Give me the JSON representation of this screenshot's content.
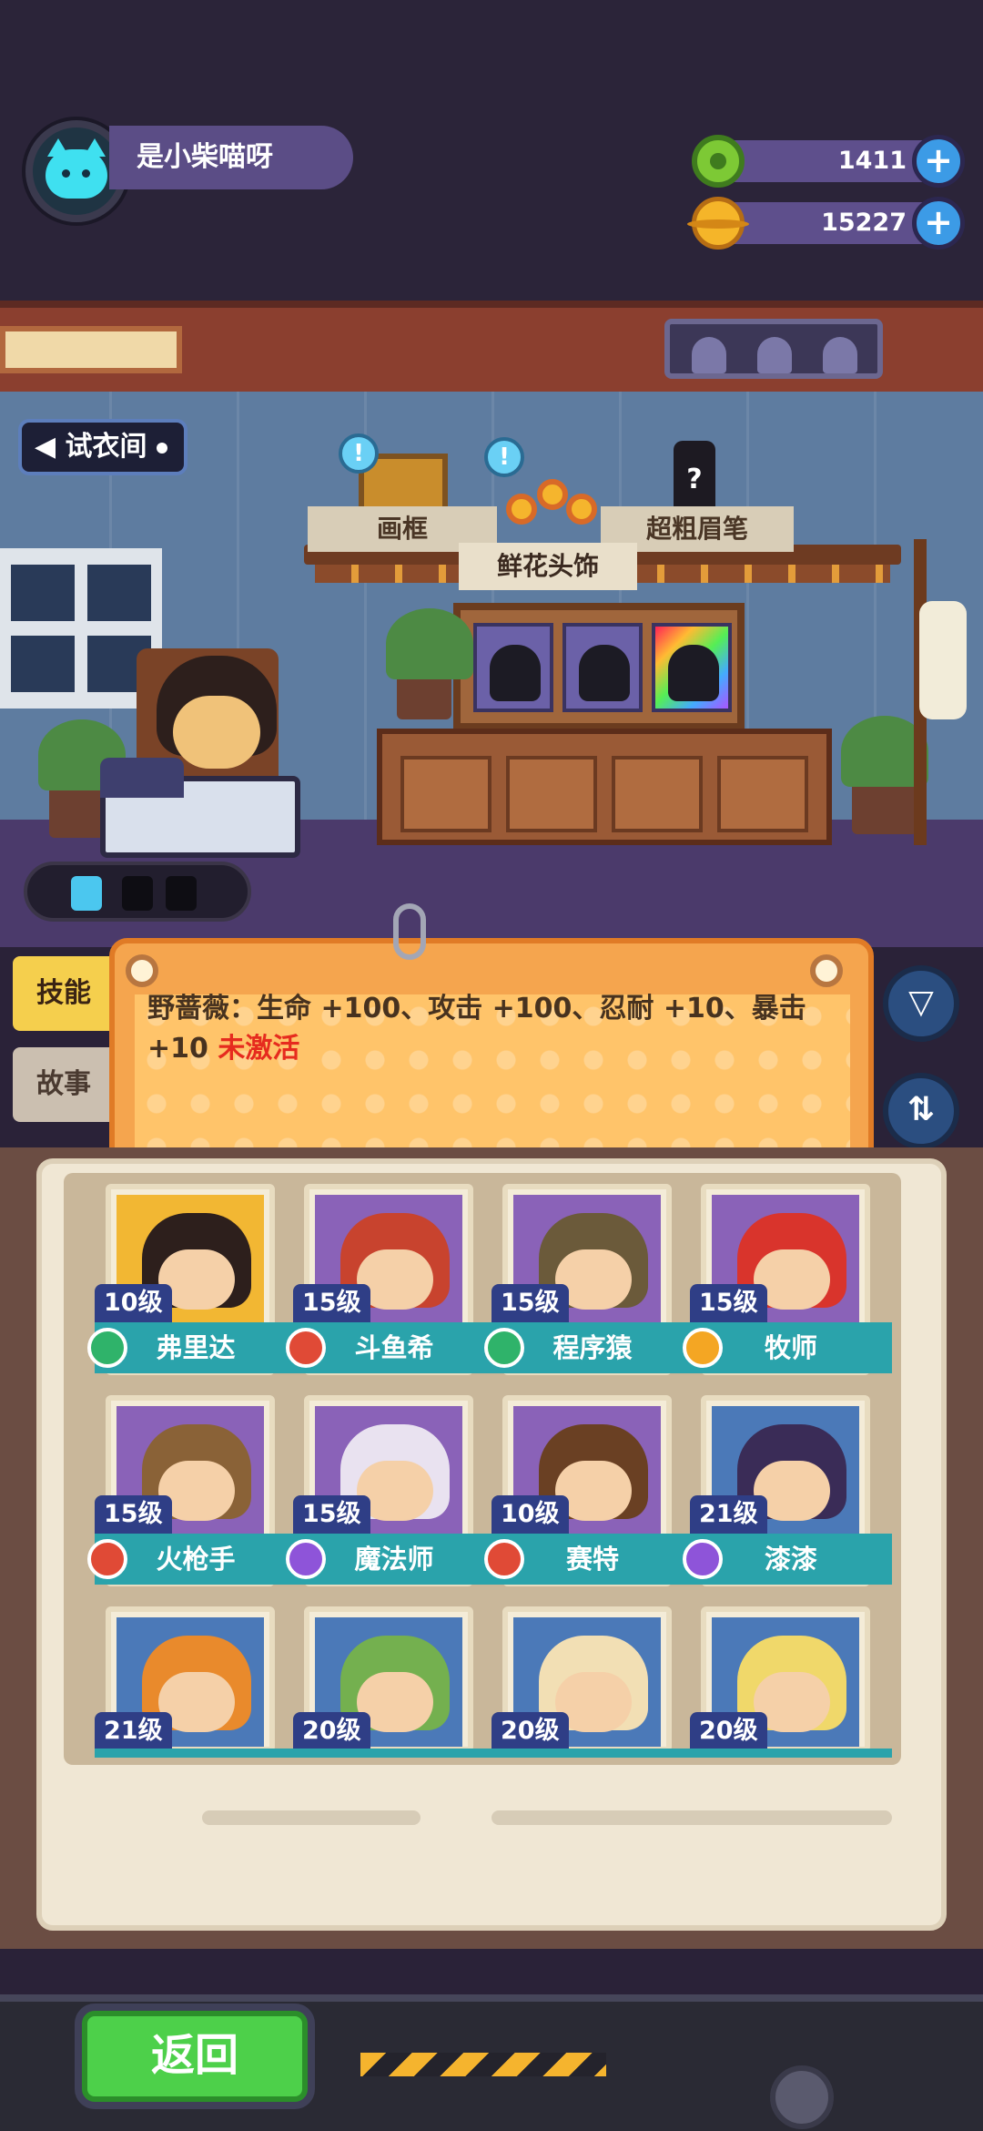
{
  "player": {
    "name": "是小柴喵呀"
  },
  "resources": [
    {
      "icon": "green-ring-currency-icon",
      "value": "1411",
      "add": "+"
    },
    {
      "icon": "gold-planet-coin-icon",
      "value": "15227",
      "add": "+"
    }
  ],
  "room": {
    "tag": "试衣间",
    "tabs": {
      "frame": "画框",
      "flower": "鲜花头饰",
      "brow": "超粗眉笔"
    },
    "bubbles": [
      "!",
      "!"
    ],
    "bottle_mark": "?"
  },
  "side_tabs": {
    "skill": "技能",
    "story": "故事"
  },
  "skill": {
    "text": "野蔷薇：生命 +100、攻击 +100、忍耐 +10、暴击 +10",
    "status": "未激活"
  },
  "side_buttons": {
    "filter": "filter-icon",
    "sort": "sort-icon"
  },
  "characters": [
    {
      "level": "10级",
      "name": "弗里达",
      "badge": "green",
      "bg": "#f2b733",
      "hair": "#2d1f1c"
    },
    {
      "level": "15级",
      "name": "斗鱼希",
      "badge": "red",
      "bg": "#8a62b8",
      "hair": "#c8432e"
    },
    {
      "level": "15级",
      "name": "程序猿",
      "badge": "green",
      "bg": "#8a62b8",
      "hair": "#6b5a3a"
    },
    {
      "level": "15级",
      "name": "牧师",
      "badge": "orange",
      "bg": "#8a62b8",
      "hair": "#d9342c"
    },
    {
      "level": "15级",
      "name": "火枪手",
      "badge": "red",
      "bg": "#8a62b8",
      "hair": "#8a6237"
    },
    {
      "level": "15级",
      "name": "魔法师",
      "badge": "purple",
      "bg": "#8a62b8",
      "hair": "#e9e2f0"
    },
    {
      "level": "10级",
      "name": "赛特",
      "badge": "red",
      "bg": "#8a62b8",
      "hair": "#6a4023"
    },
    {
      "level": "21级",
      "name": "漆漆",
      "badge": "purple",
      "bg": "#4b79b8",
      "hair": "#3a2c57"
    },
    {
      "level": "21级",
      "name": "",
      "badge": "",
      "bg": "#4b79b8",
      "hair": "#e98a2c"
    },
    {
      "level": "20级",
      "name": "",
      "badge": "",
      "bg": "#4b79b8",
      "hair": "#74b04f"
    },
    {
      "level": "20级",
      "name": "",
      "badge": "",
      "bg": "#4b79b8",
      "hair": "#f2dfb4"
    },
    {
      "level": "20级",
      "name": "",
      "badge": "",
      "bg": "#4b79b8",
      "hair": "#f0d86a"
    }
  ],
  "footer": {
    "back": "返回"
  }
}
